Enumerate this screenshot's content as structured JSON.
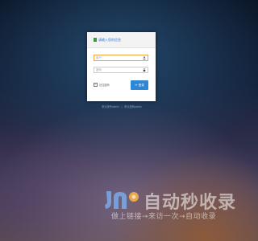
{
  "login": {
    "title": "请输入您的信息",
    "username_placeholder": "用户",
    "password_placeholder": "密码",
    "remember_label": "记住密码",
    "remember_checked": true,
    "submit_label": "登录",
    "footer_link_1": "默认帐号admin",
    "footer_separator": "|",
    "footer_link_2": "默认密码admin"
  },
  "watermark": {
    "title": "自动秒收录",
    "subtitle": "做上链接→来访一次→自动收录"
  },
  "colors": {
    "accent": "#2f86d5",
    "active_border": "#f0a640",
    "header_text": "#2f7bd0",
    "header_icon": "#3a9b3a"
  }
}
